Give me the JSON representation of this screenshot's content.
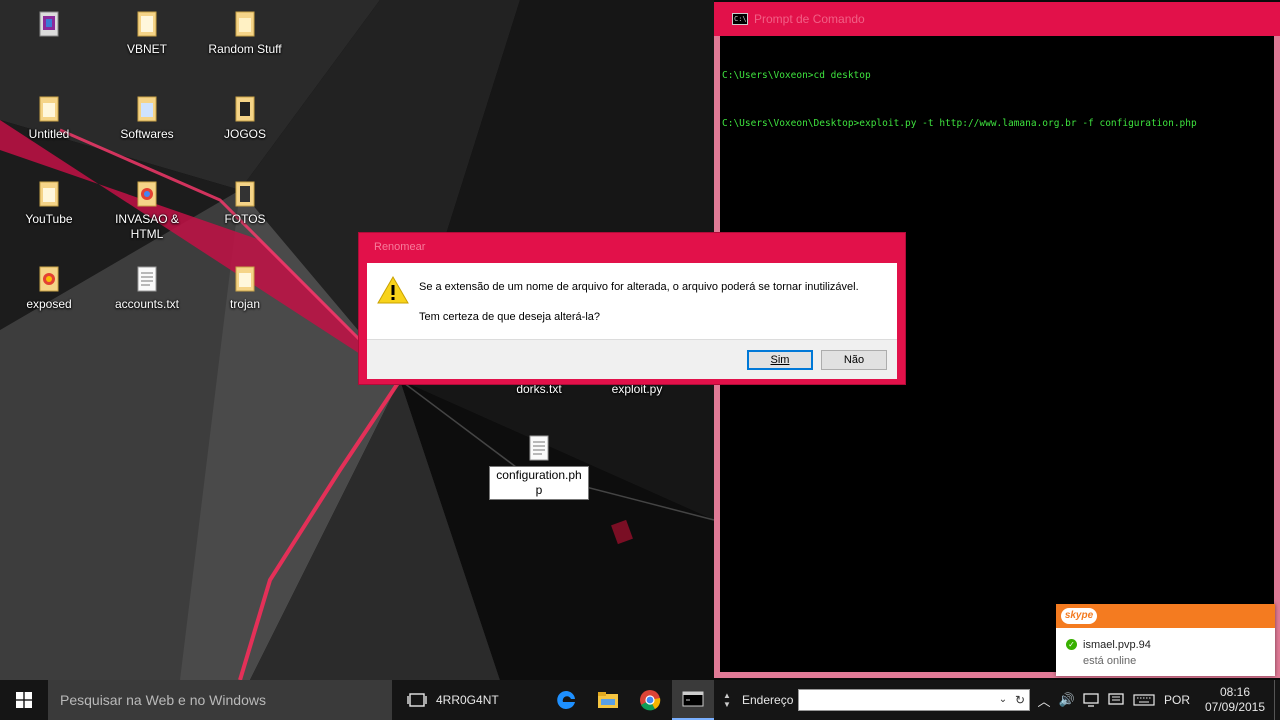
{
  "desktop": {
    "icons": [
      {
        "label": ""
      },
      {
        "label": "VBNET"
      },
      {
        "label": "Random Stuff"
      },
      {
        "label": "Untitled"
      },
      {
        "label": "Softwares"
      },
      {
        "label": "JOGOS"
      },
      {
        "label": "YouTube"
      },
      {
        "label": "INVASAO & HTML"
      },
      {
        "label": "FOTOS"
      },
      {
        "label": "exposed"
      },
      {
        "label": "accounts.txt"
      },
      {
        "label": "trojan"
      },
      {
        "label": "dorks.txt"
      },
      {
        "label": "exploit.py"
      },
      {
        "label": "configuration.php"
      }
    ]
  },
  "cmd": {
    "title": "Prompt de Comando",
    "lines": [
      "C:\\Users\\Voxeon>cd desktop",
      "C:\\Users\\Voxeon\\Desktop>exploit.py -t http://www.lamana.org.br -f configuration.php"
    ],
    "text_color": "#3ee23e"
  },
  "dialog": {
    "title": "Renomear",
    "message1": "Se a extensão de um nome de arquivo for alterada, o arquivo poderá se tornar inutilizável.",
    "message2": "Tem certeza de que deseja alterá-la?",
    "yes_label": "Sim",
    "no_label": "Não",
    "icon": "warning-icon",
    "accent": "#e2114a"
  },
  "skype": {
    "logo": "skype",
    "user": "ismael.pvp.94",
    "status": "está online",
    "accent": "#f47b20"
  },
  "taskbar": {
    "search_placeholder": "Pesquisar na Web e no Windows",
    "toolbar_label": "4RR0G4NT",
    "address_label": "Endereço",
    "address_value": "",
    "language": "POR",
    "time": "08:16",
    "date": "07/09/2015"
  }
}
